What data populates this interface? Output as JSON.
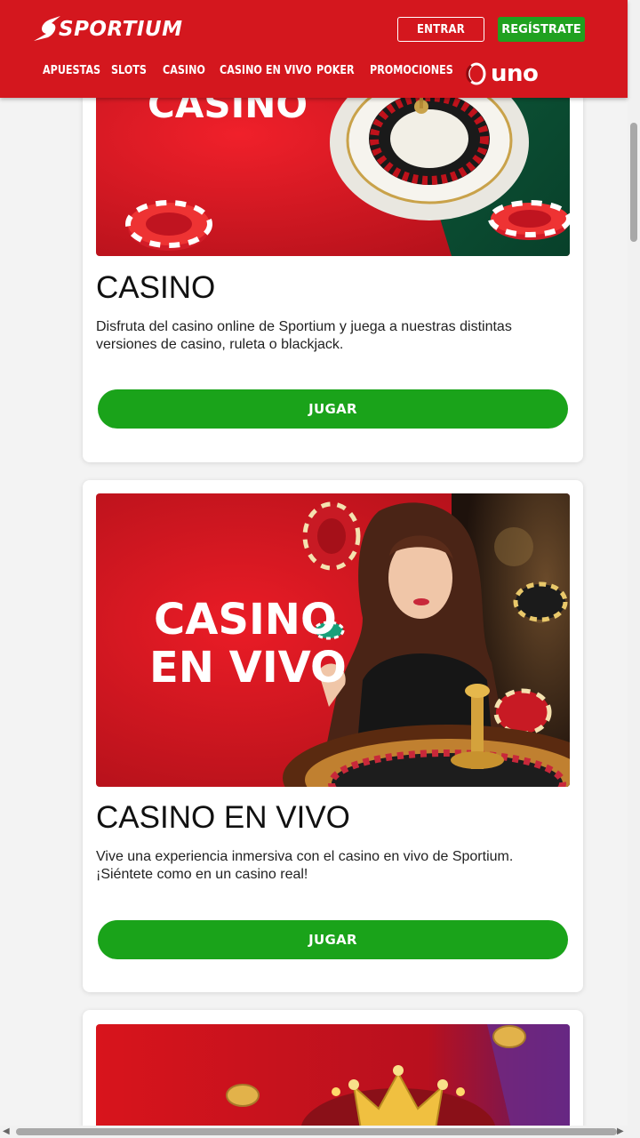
{
  "header": {
    "logo_text": "SPORTIUM",
    "login_label": "ENTRAR",
    "register_label": "REGÍSTRATE",
    "nav": [
      "APUESTAS",
      "SLOTS",
      "CASINO",
      "CASINO EN VIVO",
      "POKER",
      "PROMOCIONES"
    ],
    "partner_logo_text": "uno"
  },
  "cards": [
    {
      "image_text": "CASINO",
      "title": "CASINO",
      "description": "Disfruta del casino online de Sportium y juega a nuestras distintas versiones de casino, ruleta o blackjack.",
      "button_label": "JUGAR"
    },
    {
      "image_text_line1": "CASINO",
      "image_text_line2": "EN VIVO",
      "title": "CASINO EN VIVO",
      "description": "Vive una experiencia inmersiva con el casino en vivo de Sportium. ¡Siéntete como en un casino real!",
      "button_label": "JUGAR"
    }
  ],
  "colors": {
    "brand_red": "#d4171e",
    "cta_green": "#1aa31a"
  },
  "icons": [
    "sportium-logo-icon",
    "uno-logo-icon",
    "roulette-wheel-image",
    "casino-chip-image",
    "crown-image"
  ]
}
